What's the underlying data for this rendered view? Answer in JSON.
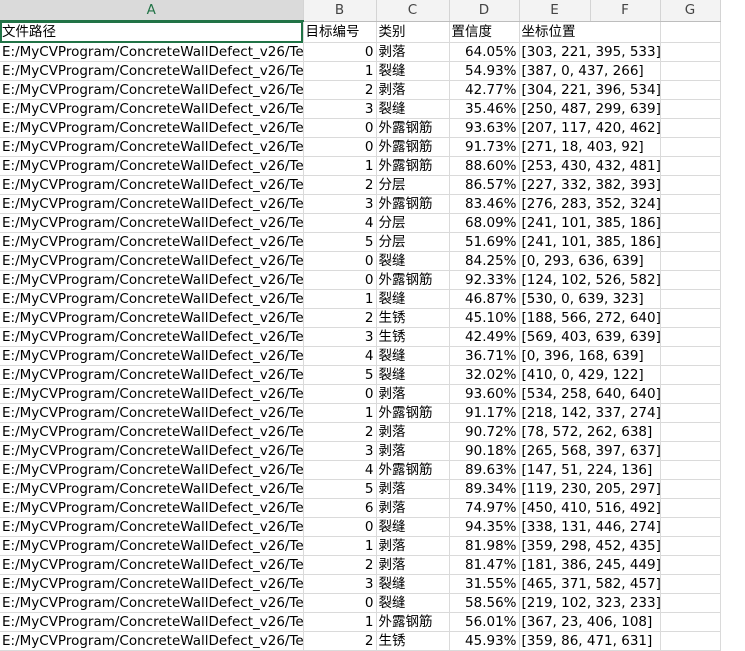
{
  "columns": [
    "A",
    "B",
    "C",
    "D",
    "E",
    "F",
    "G"
  ],
  "header": {
    "file_path": "文件路径",
    "target_id": "目标编号",
    "category": "类别",
    "confidence": "置信度",
    "coordinates": "坐标位置"
  },
  "rows": [
    {
      "path": "E:/MyCVProgram/ConcreteWallDefect_v26/Te",
      "id": "0",
      "cat": "剥落",
      "conf": "64.05%",
      "coords": "[303, 221, 395, 533]"
    },
    {
      "path": "E:/MyCVProgram/ConcreteWallDefect_v26/Te",
      "id": "1",
      "cat": "裂缝",
      "conf": "54.93%",
      "coords": "[387, 0, 437, 266]"
    },
    {
      "path": "E:/MyCVProgram/ConcreteWallDefect_v26/Te",
      "id": "2",
      "cat": "剥落",
      "conf": "42.77%",
      "coords": "[304, 221, 396, 534]"
    },
    {
      "path": "E:/MyCVProgram/ConcreteWallDefect_v26/Te",
      "id": "3",
      "cat": "裂缝",
      "conf": "35.46%",
      "coords": "[250, 487, 299, 639]"
    },
    {
      "path": "E:/MyCVProgram/ConcreteWallDefect_v26/Te",
      "id": "0",
      "cat": "外露钢筋",
      "conf": "93.63%",
      "coords": "[207, 117, 420, 462]"
    },
    {
      "path": "E:/MyCVProgram/ConcreteWallDefect_v26/Te",
      "id": "0",
      "cat": "外露钢筋",
      "conf": "91.73%",
      "coords": "[271, 18, 403, 92]"
    },
    {
      "path": "E:/MyCVProgram/ConcreteWallDefect_v26/Te",
      "id": "1",
      "cat": "外露钢筋",
      "conf": "88.60%",
      "coords": "[253, 430, 432, 481]"
    },
    {
      "path": "E:/MyCVProgram/ConcreteWallDefect_v26/Te",
      "id": "2",
      "cat": "分层",
      "conf": "86.57%",
      "coords": "[227, 332, 382, 393]"
    },
    {
      "path": "E:/MyCVProgram/ConcreteWallDefect_v26/Te",
      "id": "3",
      "cat": "外露钢筋",
      "conf": "83.46%",
      "coords": "[276, 283, 352, 324]"
    },
    {
      "path": "E:/MyCVProgram/ConcreteWallDefect_v26/Te",
      "id": "4",
      "cat": "分层",
      "conf": "68.09%",
      "coords": "[241, 101, 385, 186]"
    },
    {
      "path": "E:/MyCVProgram/ConcreteWallDefect_v26/Te",
      "id": "5",
      "cat": "分层",
      "conf": "51.69%",
      "coords": "[241, 101, 385, 186]"
    },
    {
      "path": "E:/MyCVProgram/ConcreteWallDefect_v26/Te",
      "id": "0",
      "cat": "裂缝",
      "conf": "84.25%",
      "coords": "[0, 293, 636, 639]"
    },
    {
      "path": "E:/MyCVProgram/ConcreteWallDefect_v26/Te",
      "id": "0",
      "cat": "外露钢筋",
      "conf": "92.33%",
      "coords": "[124, 102, 526, 582]"
    },
    {
      "path": "E:/MyCVProgram/ConcreteWallDefect_v26/Te",
      "id": "1",
      "cat": "裂缝",
      "conf": "46.87%",
      "coords": "[530, 0, 639, 323]"
    },
    {
      "path": "E:/MyCVProgram/ConcreteWallDefect_v26/Te",
      "id": "2",
      "cat": "生锈",
      "conf": "45.10%",
      "coords": "[188, 566, 272, 640]"
    },
    {
      "path": "E:/MyCVProgram/ConcreteWallDefect_v26/Te",
      "id": "3",
      "cat": "生锈",
      "conf": "42.49%",
      "coords": "[569, 403, 639, 639]"
    },
    {
      "path": "E:/MyCVProgram/ConcreteWallDefect_v26/Te",
      "id": "4",
      "cat": "裂缝",
      "conf": "36.71%",
      "coords": "[0, 396, 168, 639]"
    },
    {
      "path": "E:/MyCVProgram/ConcreteWallDefect_v26/Te",
      "id": "5",
      "cat": "裂缝",
      "conf": "32.02%",
      "coords": "[410, 0, 429, 122]"
    },
    {
      "path": "E:/MyCVProgram/ConcreteWallDefect_v26/Te",
      "id": "0",
      "cat": "剥落",
      "conf": "93.60%",
      "coords": "[534, 258, 640, 640]"
    },
    {
      "path": "E:/MyCVProgram/ConcreteWallDefect_v26/Te",
      "id": "1",
      "cat": "外露钢筋",
      "conf": "91.17%",
      "coords": "[218, 142, 337, 274]"
    },
    {
      "path": "E:/MyCVProgram/ConcreteWallDefect_v26/Te",
      "id": "2",
      "cat": "剥落",
      "conf": "90.72%",
      "coords": "[78, 572, 262, 638]"
    },
    {
      "path": "E:/MyCVProgram/ConcreteWallDefect_v26/Te",
      "id": "3",
      "cat": "剥落",
      "conf": "90.18%",
      "coords": "[265, 568, 397, 637]"
    },
    {
      "path": "E:/MyCVProgram/ConcreteWallDefect_v26/Te",
      "id": "4",
      "cat": "外露钢筋",
      "conf": "89.63%",
      "coords": "[147, 51, 224, 136]"
    },
    {
      "path": "E:/MyCVProgram/ConcreteWallDefect_v26/Te",
      "id": "5",
      "cat": "剥落",
      "conf": "89.34%",
      "coords": "[119, 230, 205, 297]"
    },
    {
      "path": "E:/MyCVProgram/ConcreteWallDefect_v26/Te",
      "id": "6",
      "cat": "剥落",
      "conf": "74.97%",
      "coords": "[450, 410, 516, 492]"
    },
    {
      "path": "E:/MyCVProgram/ConcreteWallDefect_v26/Te",
      "id": "0",
      "cat": "裂缝",
      "conf": "94.35%",
      "coords": "[338, 131, 446, 274]"
    },
    {
      "path": "E:/MyCVProgram/ConcreteWallDefect_v26/Te",
      "id": "1",
      "cat": "剥落",
      "conf": "81.98%",
      "coords": "[359, 298, 452, 435]"
    },
    {
      "path": "E:/MyCVProgram/ConcreteWallDefect_v26/Te",
      "id": "2",
      "cat": "剥落",
      "conf": "81.47%",
      "coords": "[181, 386, 245, 449]"
    },
    {
      "path": "E:/MyCVProgram/ConcreteWallDefect_v26/Te",
      "id": "3",
      "cat": "裂缝",
      "conf": "31.55%",
      "coords": "[465, 371, 582, 457]"
    },
    {
      "path": "E:/MyCVProgram/ConcreteWallDefect_v26/Te",
      "id": "0",
      "cat": "裂缝",
      "conf": "58.56%",
      "coords": "[219, 102, 323, 233]"
    },
    {
      "path": "E:/MyCVProgram/ConcreteWallDefect_v26/Te",
      "id": "1",
      "cat": "外露钢筋",
      "conf": "56.01%",
      "coords": "[367, 23, 406, 108]"
    },
    {
      "path": "E:/MyCVProgram/ConcreteWallDefect_v26/Te",
      "id": "2",
      "cat": "生锈",
      "conf": "45.93%",
      "coords": "[359, 86, 471, 631]"
    }
  ],
  "colors": {
    "accent": "#217346",
    "header_bg": "#f3f3f3",
    "gridline": "#dadada"
  }
}
